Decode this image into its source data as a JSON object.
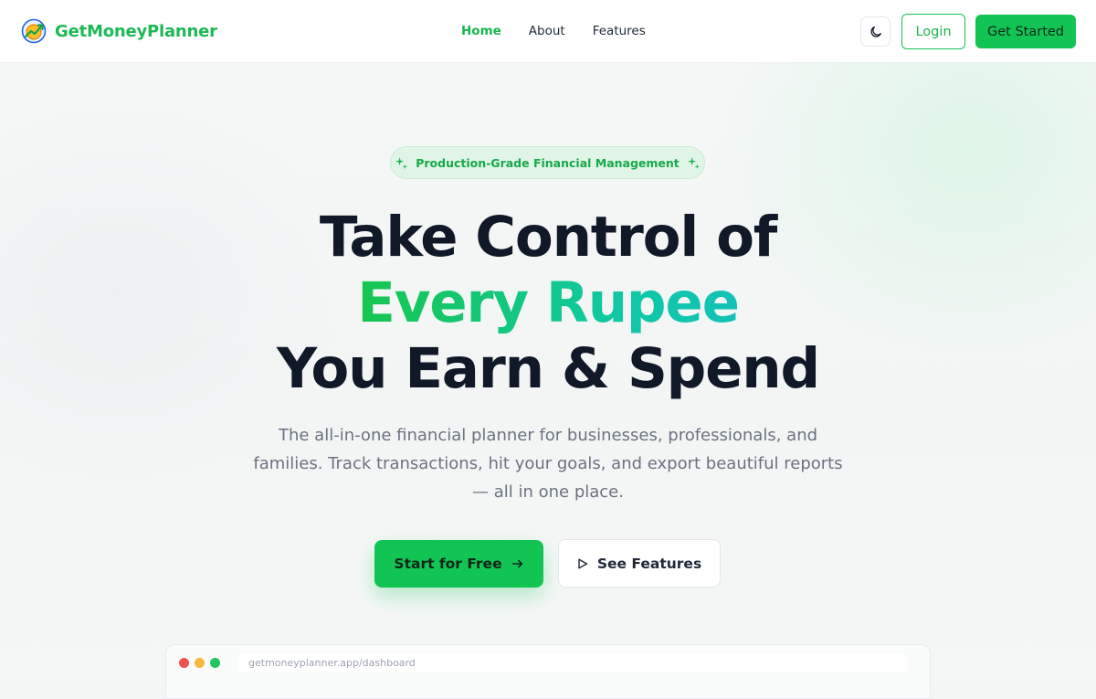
{
  "nav": {
    "brand_name": "GetMoneyPlanner",
    "links": [
      "Home",
      "About",
      "Features"
    ],
    "login_label": "Login",
    "get_started_label": "Get Started",
    "theme_icon": "moon-icon"
  },
  "hero": {
    "badge_text": "Production-Grade Financial Management",
    "headline_line1": "Take Control of",
    "headline_accent": "Every Rupee",
    "headline_line3": "You Earn & Spend",
    "subtext": "The all-in-one financial planner for businesses, professionals, and families. Track transactions, hit your goals, and export beautiful reports — all in one place.",
    "cta_primary_label": "Start for Free",
    "cta_secondary_label": "See Features"
  },
  "mockup": {
    "url": "getmoneyplanner.app/dashboard"
  },
  "colors": {
    "brand_green": "#16b74b",
    "button_green": "#12c454",
    "accent_teal": "#12c2b7",
    "heading": "#111827"
  }
}
